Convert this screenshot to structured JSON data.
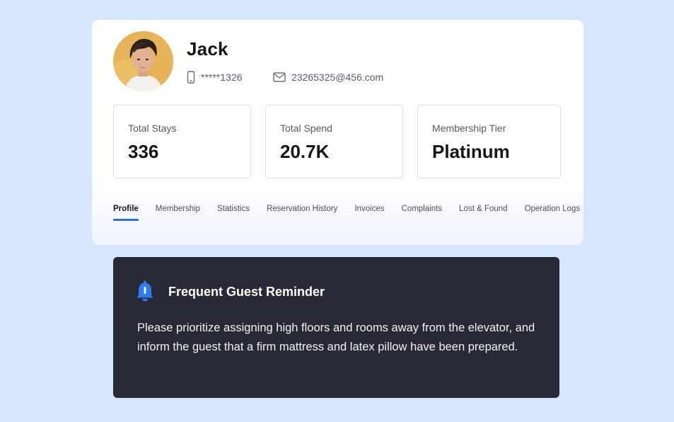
{
  "guest": {
    "name": "Jack",
    "phone": "*****1326",
    "email": "23265325@456.com",
    "avatar_alt": "guest-avatar"
  },
  "stats": [
    {
      "label": "Total Stays",
      "value": "336"
    },
    {
      "label": "Total Spend",
      "value": "20.7K"
    },
    {
      "label": "Membership Tier",
      "value": "Platinum"
    }
  ],
  "tabs": [
    {
      "label": "Profile",
      "active": true
    },
    {
      "label": "Membership"
    },
    {
      "label": "Statistics"
    },
    {
      "label": "Reservation History"
    },
    {
      "label": "Invoices"
    },
    {
      "label": "Complaints"
    },
    {
      "label": "Lost & Found"
    },
    {
      "label": "Operation Logs"
    }
  ],
  "reminder": {
    "title": "Frequent Guest Reminder",
    "body": "Please prioritize assigning high floors and rooms away from the elevator, and inform the guest that a firm mattress and latex pillow have been prepared."
  },
  "colors": {
    "background": "#d6e6fc",
    "accent": "#2a6fdb",
    "reminder_bg": "#272a36"
  },
  "icons": {
    "phone": "phone-icon",
    "email": "email-icon",
    "reminder": "bell-icon"
  }
}
